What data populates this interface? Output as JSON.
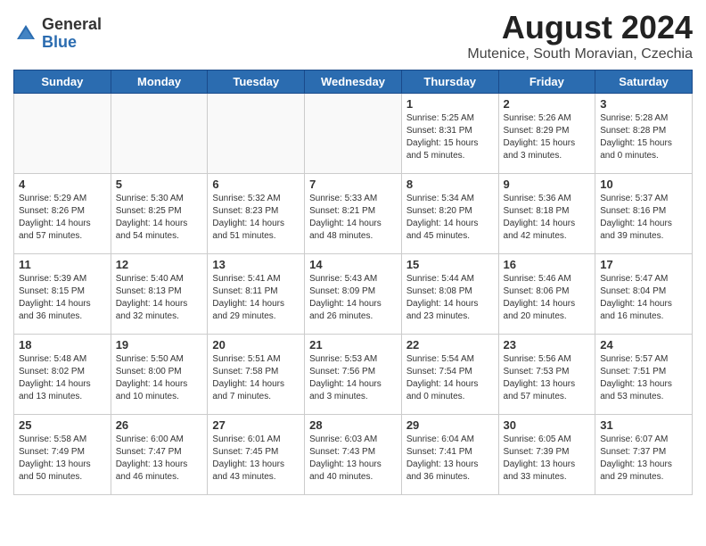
{
  "header": {
    "logo_general": "General",
    "logo_blue": "Blue",
    "month_year": "August 2024",
    "location": "Mutenice, South Moravian, Czechia"
  },
  "days_of_week": [
    "Sunday",
    "Monday",
    "Tuesday",
    "Wednesday",
    "Thursday",
    "Friday",
    "Saturday"
  ],
  "weeks": [
    [
      {
        "day": "",
        "info": ""
      },
      {
        "day": "",
        "info": ""
      },
      {
        "day": "",
        "info": ""
      },
      {
        "day": "",
        "info": ""
      },
      {
        "day": "1",
        "info": "Sunrise: 5:25 AM\nSunset: 8:31 PM\nDaylight: 15 hours\nand 5 minutes."
      },
      {
        "day": "2",
        "info": "Sunrise: 5:26 AM\nSunset: 8:29 PM\nDaylight: 15 hours\nand 3 minutes."
      },
      {
        "day": "3",
        "info": "Sunrise: 5:28 AM\nSunset: 8:28 PM\nDaylight: 15 hours\nand 0 minutes."
      }
    ],
    [
      {
        "day": "4",
        "info": "Sunrise: 5:29 AM\nSunset: 8:26 PM\nDaylight: 14 hours\nand 57 minutes."
      },
      {
        "day": "5",
        "info": "Sunrise: 5:30 AM\nSunset: 8:25 PM\nDaylight: 14 hours\nand 54 minutes."
      },
      {
        "day": "6",
        "info": "Sunrise: 5:32 AM\nSunset: 8:23 PM\nDaylight: 14 hours\nand 51 minutes."
      },
      {
        "day": "7",
        "info": "Sunrise: 5:33 AM\nSunset: 8:21 PM\nDaylight: 14 hours\nand 48 minutes."
      },
      {
        "day": "8",
        "info": "Sunrise: 5:34 AM\nSunset: 8:20 PM\nDaylight: 14 hours\nand 45 minutes."
      },
      {
        "day": "9",
        "info": "Sunrise: 5:36 AM\nSunset: 8:18 PM\nDaylight: 14 hours\nand 42 minutes."
      },
      {
        "day": "10",
        "info": "Sunrise: 5:37 AM\nSunset: 8:16 PM\nDaylight: 14 hours\nand 39 minutes."
      }
    ],
    [
      {
        "day": "11",
        "info": "Sunrise: 5:39 AM\nSunset: 8:15 PM\nDaylight: 14 hours\nand 36 minutes."
      },
      {
        "day": "12",
        "info": "Sunrise: 5:40 AM\nSunset: 8:13 PM\nDaylight: 14 hours\nand 32 minutes."
      },
      {
        "day": "13",
        "info": "Sunrise: 5:41 AM\nSunset: 8:11 PM\nDaylight: 14 hours\nand 29 minutes."
      },
      {
        "day": "14",
        "info": "Sunrise: 5:43 AM\nSunset: 8:09 PM\nDaylight: 14 hours\nand 26 minutes."
      },
      {
        "day": "15",
        "info": "Sunrise: 5:44 AM\nSunset: 8:08 PM\nDaylight: 14 hours\nand 23 minutes."
      },
      {
        "day": "16",
        "info": "Sunrise: 5:46 AM\nSunset: 8:06 PM\nDaylight: 14 hours\nand 20 minutes."
      },
      {
        "day": "17",
        "info": "Sunrise: 5:47 AM\nSunset: 8:04 PM\nDaylight: 14 hours\nand 16 minutes."
      }
    ],
    [
      {
        "day": "18",
        "info": "Sunrise: 5:48 AM\nSunset: 8:02 PM\nDaylight: 14 hours\nand 13 minutes."
      },
      {
        "day": "19",
        "info": "Sunrise: 5:50 AM\nSunset: 8:00 PM\nDaylight: 14 hours\nand 10 minutes."
      },
      {
        "day": "20",
        "info": "Sunrise: 5:51 AM\nSunset: 7:58 PM\nDaylight: 14 hours\nand 7 minutes."
      },
      {
        "day": "21",
        "info": "Sunrise: 5:53 AM\nSunset: 7:56 PM\nDaylight: 14 hours\nand 3 minutes."
      },
      {
        "day": "22",
        "info": "Sunrise: 5:54 AM\nSunset: 7:54 PM\nDaylight: 14 hours\nand 0 minutes."
      },
      {
        "day": "23",
        "info": "Sunrise: 5:56 AM\nSunset: 7:53 PM\nDaylight: 13 hours\nand 57 minutes."
      },
      {
        "day": "24",
        "info": "Sunrise: 5:57 AM\nSunset: 7:51 PM\nDaylight: 13 hours\nand 53 minutes."
      }
    ],
    [
      {
        "day": "25",
        "info": "Sunrise: 5:58 AM\nSunset: 7:49 PM\nDaylight: 13 hours\nand 50 minutes."
      },
      {
        "day": "26",
        "info": "Sunrise: 6:00 AM\nSunset: 7:47 PM\nDaylight: 13 hours\nand 46 minutes."
      },
      {
        "day": "27",
        "info": "Sunrise: 6:01 AM\nSunset: 7:45 PM\nDaylight: 13 hours\nand 43 minutes."
      },
      {
        "day": "28",
        "info": "Sunrise: 6:03 AM\nSunset: 7:43 PM\nDaylight: 13 hours\nand 40 minutes."
      },
      {
        "day": "29",
        "info": "Sunrise: 6:04 AM\nSunset: 7:41 PM\nDaylight: 13 hours\nand 36 minutes."
      },
      {
        "day": "30",
        "info": "Sunrise: 6:05 AM\nSunset: 7:39 PM\nDaylight: 13 hours\nand 33 minutes."
      },
      {
        "day": "31",
        "info": "Sunrise: 6:07 AM\nSunset: 7:37 PM\nDaylight: 13 hours\nand 29 minutes."
      }
    ]
  ]
}
